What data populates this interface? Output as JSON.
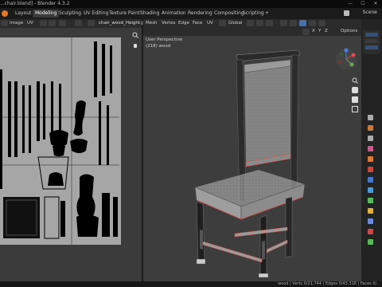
{
  "window": {
    "title": "...chair.blend] - Blender 4.3.2"
  },
  "tabs": [
    "Layout",
    "Modeling",
    "Sculpting",
    "UV Editing",
    "Texture Paint",
    "Shading",
    "Animation",
    "Rendering",
    "Compositing",
    "Scripting"
  ],
  "active_tab": "Modeling",
  "add_tab": "+",
  "scene": "Scene",
  "uv_editor": {
    "menu": [
      "Image",
      "UV"
    ],
    "image_name": "chair_wood_Height.jpg"
  },
  "viewport": {
    "menu": [
      "Mesh",
      "Vertex",
      "Edge",
      "Face",
      "UV"
    ],
    "orientation": "Global",
    "options": "Options",
    "view_name": "User Perspective",
    "object_name": "(218) wood",
    "axes": [
      "X",
      "Y",
      "Z"
    ]
  },
  "status": {
    "text": "wood | Verts 0/21,744 | Edges 0/43,318 | Faces 0/..."
  },
  "colors": {
    "active_tab": "#3a3a3a",
    "selection": "#e0761d",
    "x_axis": "#e04a4a",
    "y_axis": "#6aa84f",
    "z_axis": "#4a7de0"
  }
}
